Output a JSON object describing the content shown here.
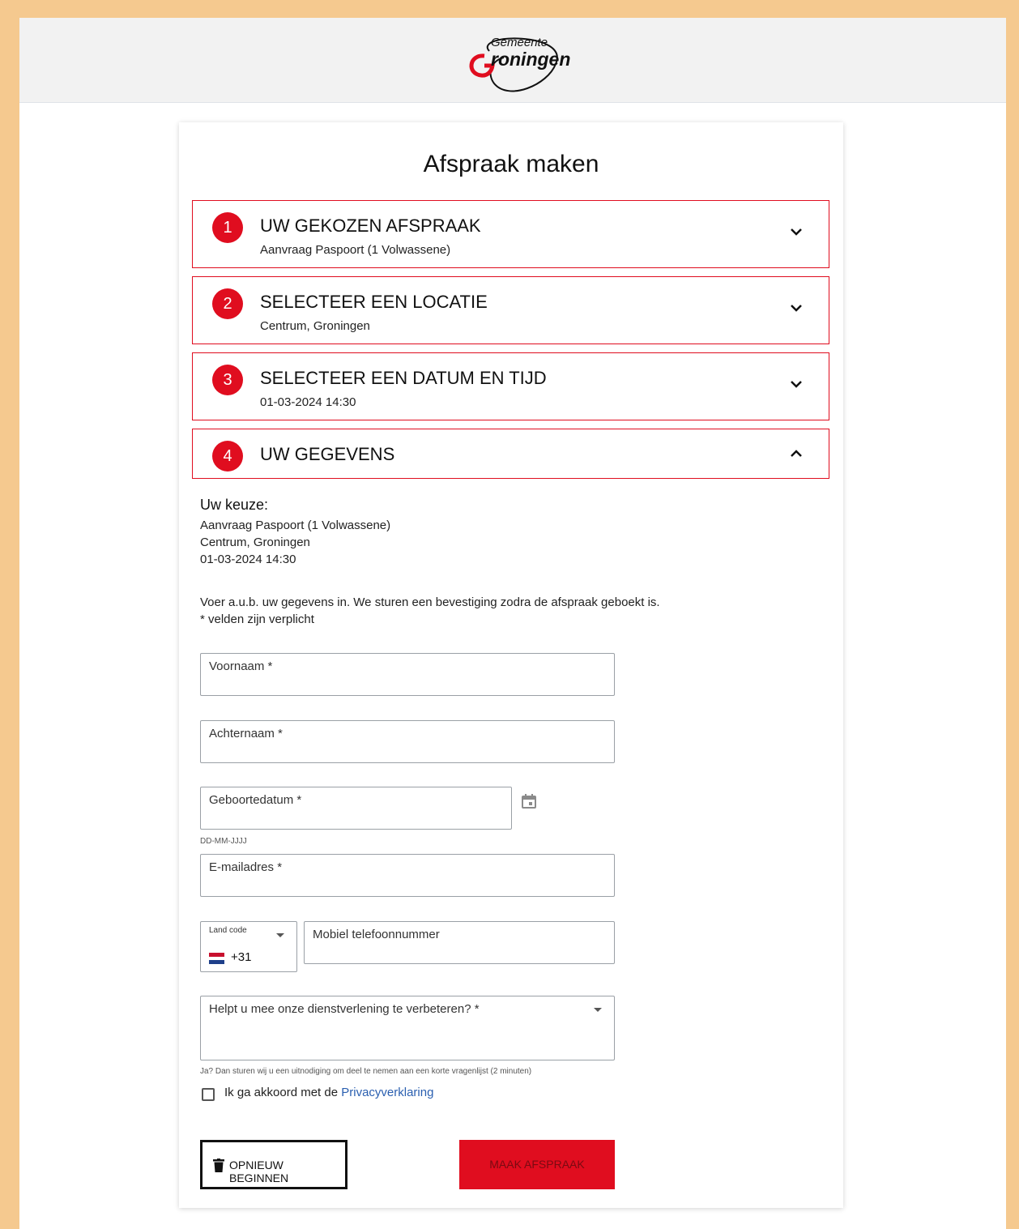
{
  "brand": {
    "logo_top": "Gemeente",
    "logo_main": "Groningen",
    "accent_color": "#e00d1f"
  },
  "page": {
    "title": "Afspraak maken"
  },
  "steps": [
    {
      "number": "1",
      "title": "UW GEKOZEN AFSPRAAK",
      "subtitle": "Aanvraag Paspoort (1 Volwassene)",
      "state": "collapsed",
      "icon": "chevron-down-icon"
    },
    {
      "number": "2",
      "title": "SELECTEER EEN LOCATIE",
      "subtitle": "Centrum, Groningen",
      "state": "collapsed",
      "icon": "chevron-down-icon"
    },
    {
      "number": "3",
      "title": "SELECTEER EEN DATUM EN TIJD",
      "subtitle": "01-03-2024 14:30",
      "state": "collapsed",
      "icon": "chevron-down-icon"
    },
    {
      "number": "4",
      "title": "UW GEGEVENS",
      "subtitle": "",
      "state": "expanded",
      "icon": "chevron-up-icon"
    }
  ],
  "summary": {
    "heading": "Uw keuze:",
    "lines": [
      "Aanvraag Paspoort (1 Volwassene)",
      "Centrum, Groningen",
      "01-03-2024 14:30"
    ]
  },
  "intro": {
    "line1": "Voer a.u.b. uw gegevens in. We sturen een bevestiging zodra de afspraak geboekt is.",
    "line2": "* velden zijn verplicht"
  },
  "form": {
    "first_name": {
      "label": "Voornaam *",
      "value": ""
    },
    "last_name": {
      "label": "Achternaam *",
      "value": ""
    },
    "birthdate": {
      "label": "Geboortedatum *",
      "value": "",
      "hint": "DD-MM-JJJJ",
      "icon": "calendar-icon"
    },
    "email": {
      "label": "E-mailadres *",
      "value": ""
    },
    "country_code": {
      "label": "Land code",
      "value": "+31",
      "flag": "netherlands-flag"
    },
    "phone": {
      "label": "Mobiel telefoonnummer",
      "value": ""
    },
    "improve": {
      "label": "Helpt u mee onze dienstverlening te verbeteren? *",
      "value": "",
      "hint": "Ja? Dan sturen wij u een uitnodiging om deel te nemen aan een korte vragenlijst (2 minuten)"
    },
    "privacy": {
      "text": "Ik ga akkoord met de ",
      "link": "Privacyverklaring",
      "checked": false
    }
  },
  "buttons": {
    "reset": {
      "label": "OPNIEUW BEGINNEN",
      "icon": "trash-icon"
    },
    "submit": {
      "label": "MAAK AFSPRAAK"
    }
  }
}
